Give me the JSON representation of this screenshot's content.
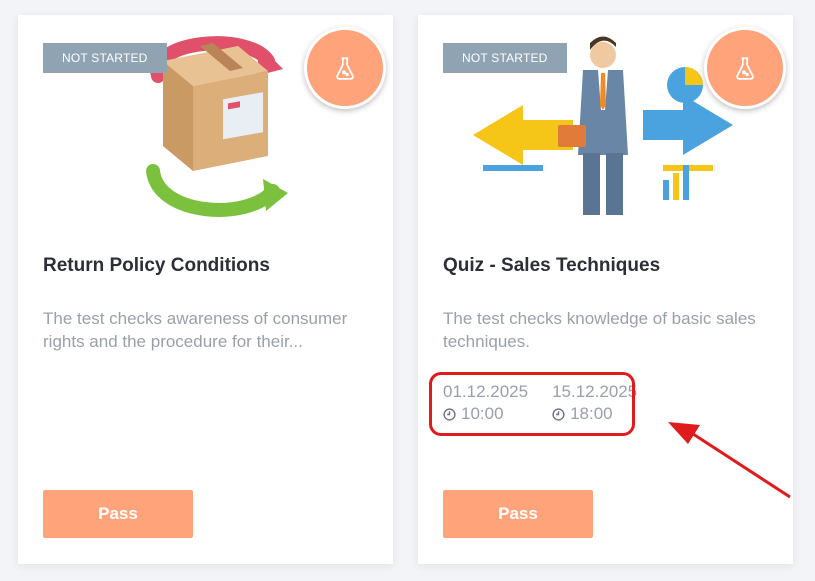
{
  "cards": [
    {
      "status": "NOT STARTED",
      "title": "Return Policy Conditions",
      "description": "The test checks awareness of consumer rights and the procedure for their...",
      "button": "Pass",
      "icon": "flask-icon",
      "thumbnail": "box-return-arrows-image"
    },
    {
      "status": "NOT STARTED",
      "title": "Quiz - Sales Techniques",
      "description": "The test checks knowledge of basic sales techniques.",
      "start_date": "01.12.2025",
      "start_time": "10:00",
      "end_date": "15.12.2025",
      "end_time": "18:00",
      "button": "Pass",
      "icon": "flask-icon",
      "thumbnail": "businessman-infographic-image"
    }
  ],
  "colors": {
    "accent": "#ffa47a",
    "badge": "#8fa3b3",
    "annotation": "#e01b1b"
  }
}
